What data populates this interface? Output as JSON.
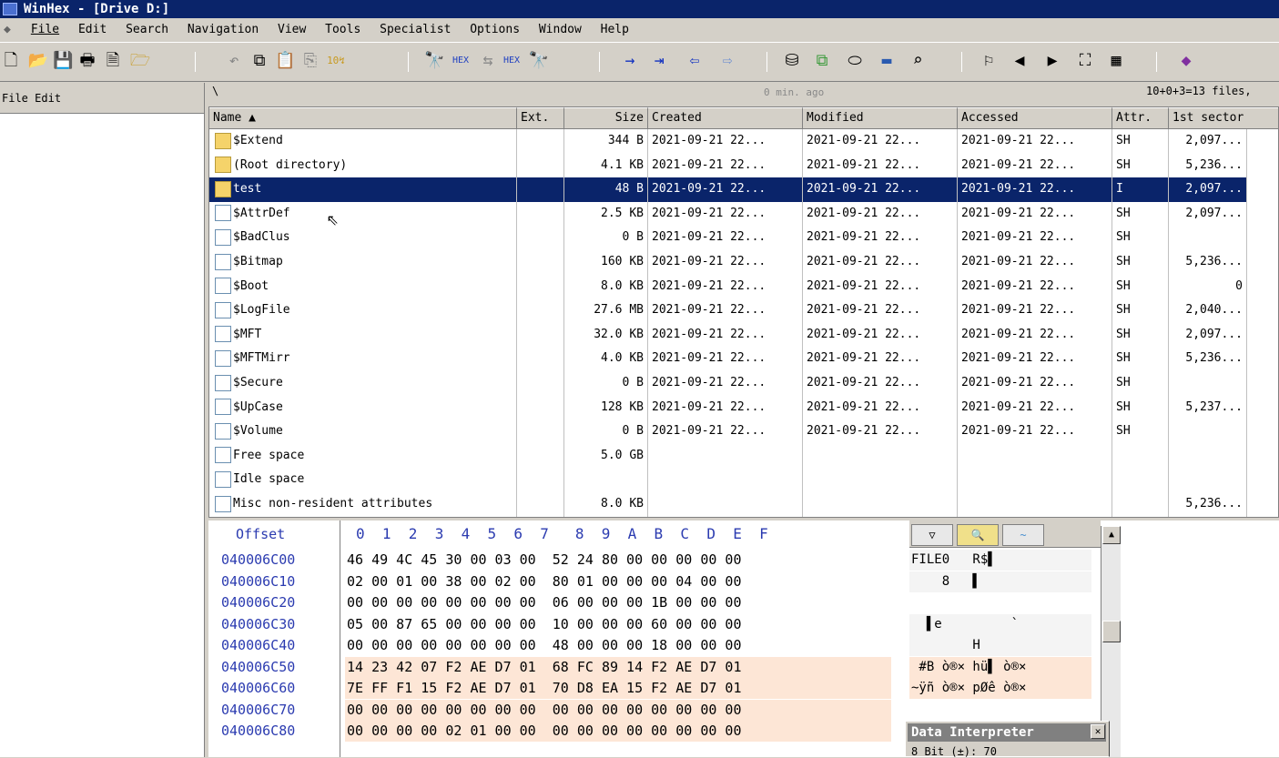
{
  "window": {
    "title": "WinHex - [Drive D:]"
  },
  "menu": [
    "File",
    "Edit",
    "Search",
    "Navigation",
    "View",
    "Tools",
    "Specialist",
    "Options",
    "Window",
    "Help"
  ],
  "toolbar_icons": [
    "new-icon",
    "open-icon",
    "save-icon",
    "print-icon",
    "properties-icon",
    "case-icon",
    "undo-icon",
    "copy-icon",
    "paste-icon",
    "paste-write-icon",
    "convert-icon",
    "find-text-icon",
    "find-hex-icon",
    "replace-text-icon",
    "replace-hex-icon",
    "find-next-icon",
    "goto-offset-icon",
    "goto-sector-icon",
    "back-icon",
    "forward-icon",
    "open-disk-icon",
    "clone-icon",
    "disk-image-icon",
    "ram-icon",
    "magnify-icon",
    "snapshot-icon",
    "prev-icon",
    "next-icon",
    "camera-icon",
    "grid-icon",
    "help-icon"
  ],
  "left_pane": {
    "file_label": "File",
    "edit_label": "Edit"
  },
  "pathbar": {
    "path": "\\",
    "ago": "0 min. ago",
    "count": "10+0+3=13 files,"
  },
  "columns": [
    "Name ▲",
    "Ext.",
    "Size",
    "Created",
    "Modified",
    "Accessed",
    "Attr.",
    "1st sector"
  ],
  "rows": [
    {
      "name": "$Extend",
      "ext": "",
      "size": "344 B",
      "created": "2021-09-21  22...",
      "modified": "2021-09-21  22...",
      "accessed": "2021-09-21  22...",
      "attr": "SH",
      "sector": "2,097...",
      "icon": "folder"
    },
    {
      "name": "(Root directory)",
      "ext": "",
      "size": "4.1 KB",
      "created": "2021-09-21  22...",
      "modified": "2021-09-21  22...",
      "accessed": "2021-09-21  22...",
      "attr": "SH",
      "sector": "5,236...",
      "icon": "folder"
    },
    {
      "name": "test",
      "ext": "",
      "size": "48 B",
      "created": "2021-09-21  22...",
      "modified": "2021-09-21  22...",
      "accessed": "2021-09-21  22...",
      "attr": "I",
      "sector": "2,097...",
      "icon": "folder",
      "selected": true
    },
    {
      "name": "$AttrDef",
      "ext": "",
      "size": "2.5 KB",
      "created": "2021-09-21  22...",
      "modified": "2021-09-21  22...",
      "accessed": "2021-09-21  22...",
      "attr": "SH",
      "sector": "2,097...",
      "icon": "doc"
    },
    {
      "name": "$BadClus",
      "ext": "",
      "size": "0 B",
      "created": "2021-09-21  22...",
      "modified": "2021-09-21  22...",
      "accessed": "2021-09-21  22...",
      "attr": "SH",
      "sector": "",
      "icon": "doc"
    },
    {
      "name": "$Bitmap",
      "ext": "",
      "size": "160 KB",
      "created": "2021-09-21  22...",
      "modified": "2021-09-21  22...",
      "accessed": "2021-09-21  22...",
      "attr": "SH",
      "sector": "5,236...",
      "icon": "doc"
    },
    {
      "name": "$Boot",
      "ext": "",
      "size": "8.0 KB",
      "created": "2021-09-21  22...",
      "modified": "2021-09-21  22...",
      "accessed": "2021-09-21  22...",
      "attr": "SH",
      "sector": "0",
      "icon": "doc"
    },
    {
      "name": "$LogFile",
      "ext": "",
      "size": "27.6 MB",
      "created": "2021-09-21  22...",
      "modified": "2021-09-21  22...",
      "accessed": "2021-09-21  22...",
      "attr": "SH",
      "sector": "2,040...",
      "icon": "doc"
    },
    {
      "name": "$MFT",
      "ext": "",
      "size": "32.0 KB",
      "created": "2021-09-21  22...",
      "modified": "2021-09-21  22...",
      "accessed": "2021-09-21  22...",
      "attr": "SH",
      "sector": "2,097...",
      "icon": "doc"
    },
    {
      "name": "$MFTMirr",
      "ext": "",
      "size": "4.0 KB",
      "created": "2021-09-21  22...",
      "modified": "2021-09-21  22...",
      "accessed": "2021-09-21  22...",
      "attr": "SH",
      "sector": "5,236...",
      "icon": "doc"
    },
    {
      "name": "$Secure",
      "ext": "",
      "size": "0 B",
      "created": "2021-09-21  22...",
      "modified": "2021-09-21  22...",
      "accessed": "2021-09-21  22...",
      "attr": "SH",
      "sector": "",
      "icon": "doc"
    },
    {
      "name": "$UpCase",
      "ext": "",
      "size": "128 KB",
      "created": "2021-09-21  22...",
      "modified": "2021-09-21  22...",
      "accessed": "2021-09-21  22...",
      "attr": "SH",
      "sector": "5,237...",
      "icon": "doc"
    },
    {
      "name": "$Volume",
      "ext": "",
      "size": "0 B",
      "created": "2021-09-21  22...",
      "modified": "2021-09-21  22...",
      "accessed": "2021-09-21  22...",
      "attr": "SH",
      "sector": "",
      "icon": "doc"
    },
    {
      "name": "Free space",
      "ext": "",
      "size": "5.0 GB",
      "created": "",
      "modified": "",
      "accessed": "",
      "attr": "",
      "sector": "",
      "icon": "doc"
    },
    {
      "name": "Idle space",
      "ext": "",
      "size": "",
      "created": "",
      "modified": "",
      "accessed": "",
      "attr": "",
      "sector": "",
      "icon": "doc"
    },
    {
      "name": "Misc non-resident attributes",
      "ext": "",
      "size": "8.0 KB",
      "created": "",
      "modified": "",
      "accessed": "",
      "attr": "",
      "sector": "5,236...",
      "icon": "doc"
    }
  ],
  "hex": {
    "offset_label": "Offset",
    "header": "0  1  2  3  4  5  6  7   8  9  A  B  C  D  E  F",
    "rows": [
      {
        "offset": "040006C00",
        "bytes": "46 49 4C 45 30 00 03 00  52 24 80 00 00 00 00 00",
        "ascii": "FILE0   R$▌"
      },
      {
        "offset": "040006C10",
        "bytes": "02 00 01 00 38 00 02 00  80 01 00 00 00 04 00 00",
        "ascii": "    8   ▌"
      },
      {
        "offset": "040006C20",
        "bytes": "00 00 00 00 00 00 00 00  06 00 00 00 1B 00 00 00",
        "ascii": ""
      },
      {
        "offset": "040006C30",
        "bytes": "05 00 87 65 00 00 00 00  10 00 00 00 60 00 00 00",
        "ascii": "  ▌e         `"
      },
      {
        "offset": "040006C40",
        "bytes": "00 00 00 00 00 00 00 00  48 00 00 00 18 00 00 00",
        "ascii": "        H"
      },
      {
        "offset": "040006C50",
        "bytes": "14 23 42 07 F2 AE D7 01  68 FC 89 14 F2 AE D7 01",
        "ascii": " #B ò®× hü▌ ò®×"
      },
      {
        "offset": "040006C60",
        "bytes": "7E FF F1 15 F2 AE D7 01  70 D8 EA 15 F2 AE D7 01",
        "ascii": "~ÿñ ò®× pØê ò®×"
      },
      {
        "offset": "040006C70",
        "bytes": "00 00 00 00 00 00 00 00  00 00 00 00 00 00 00 00",
        "ascii": ""
      },
      {
        "offset": "040006C80",
        "bytes": "00 00 00 00 02 01 00 00  00 00 00 00 00 00 00 00",
        "ascii": ""
      }
    ]
  },
  "data_interpreter": {
    "title": "Data Interpreter",
    "close": "✕",
    "value": "8 Bit (±): 70"
  }
}
